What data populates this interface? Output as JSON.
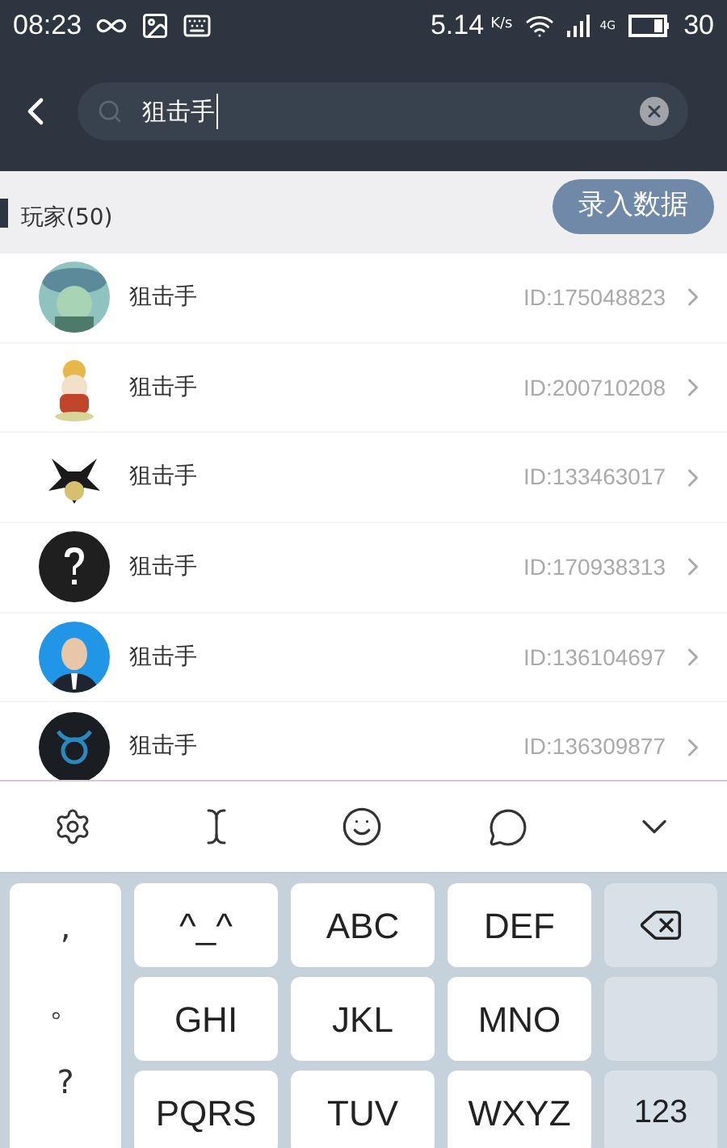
{
  "status_bar": {
    "time": "08:23",
    "speed": "5.14",
    "speed_unit": "K/s",
    "network": "4G",
    "battery": "30"
  },
  "search": {
    "value": "狙击手"
  },
  "section": {
    "title": "玩家(50)",
    "action": "录入数据"
  },
  "players": [
    {
      "name": "狙击手",
      "id": "ID:175048823"
    },
    {
      "name": "狙击手",
      "id": "ID:200710208"
    },
    {
      "name": "狙击手",
      "id": "ID:133463017"
    },
    {
      "name": "狙击手",
      "id": "ID:170938313"
    },
    {
      "name": "狙击手",
      "id": "ID:136104697"
    },
    {
      "name": "狙击手",
      "id": "ID:136309877"
    }
  ],
  "keyboard": {
    "punctuation": [
      ",",
      "。",
      "?"
    ],
    "keys": [
      {
        "kind": "key",
        "label": "^_^"
      },
      {
        "kind": "key",
        "label": "ABC"
      },
      {
        "kind": "key",
        "label": "DEF"
      },
      {
        "kind": "delete"
      },
      {
        "kind": "key",
        "label": "GHI"
      },
      {
        "kind": "key",
        "label": "JKL"
      },
      {
        "kind": "key",
        "label": "MNO"
      },
      {
        "kind": "blank"
      },
      {
        "kind": "key",
        "label": "PQRS"
      },
      {
        "kind": "key",
        "label": "TUV"
      },
      {
        "kind": "key",
        "label": "WXYZ"
      },
      {
        "kind": "function",
        "label": "123"
      }
    ]
  }
}
